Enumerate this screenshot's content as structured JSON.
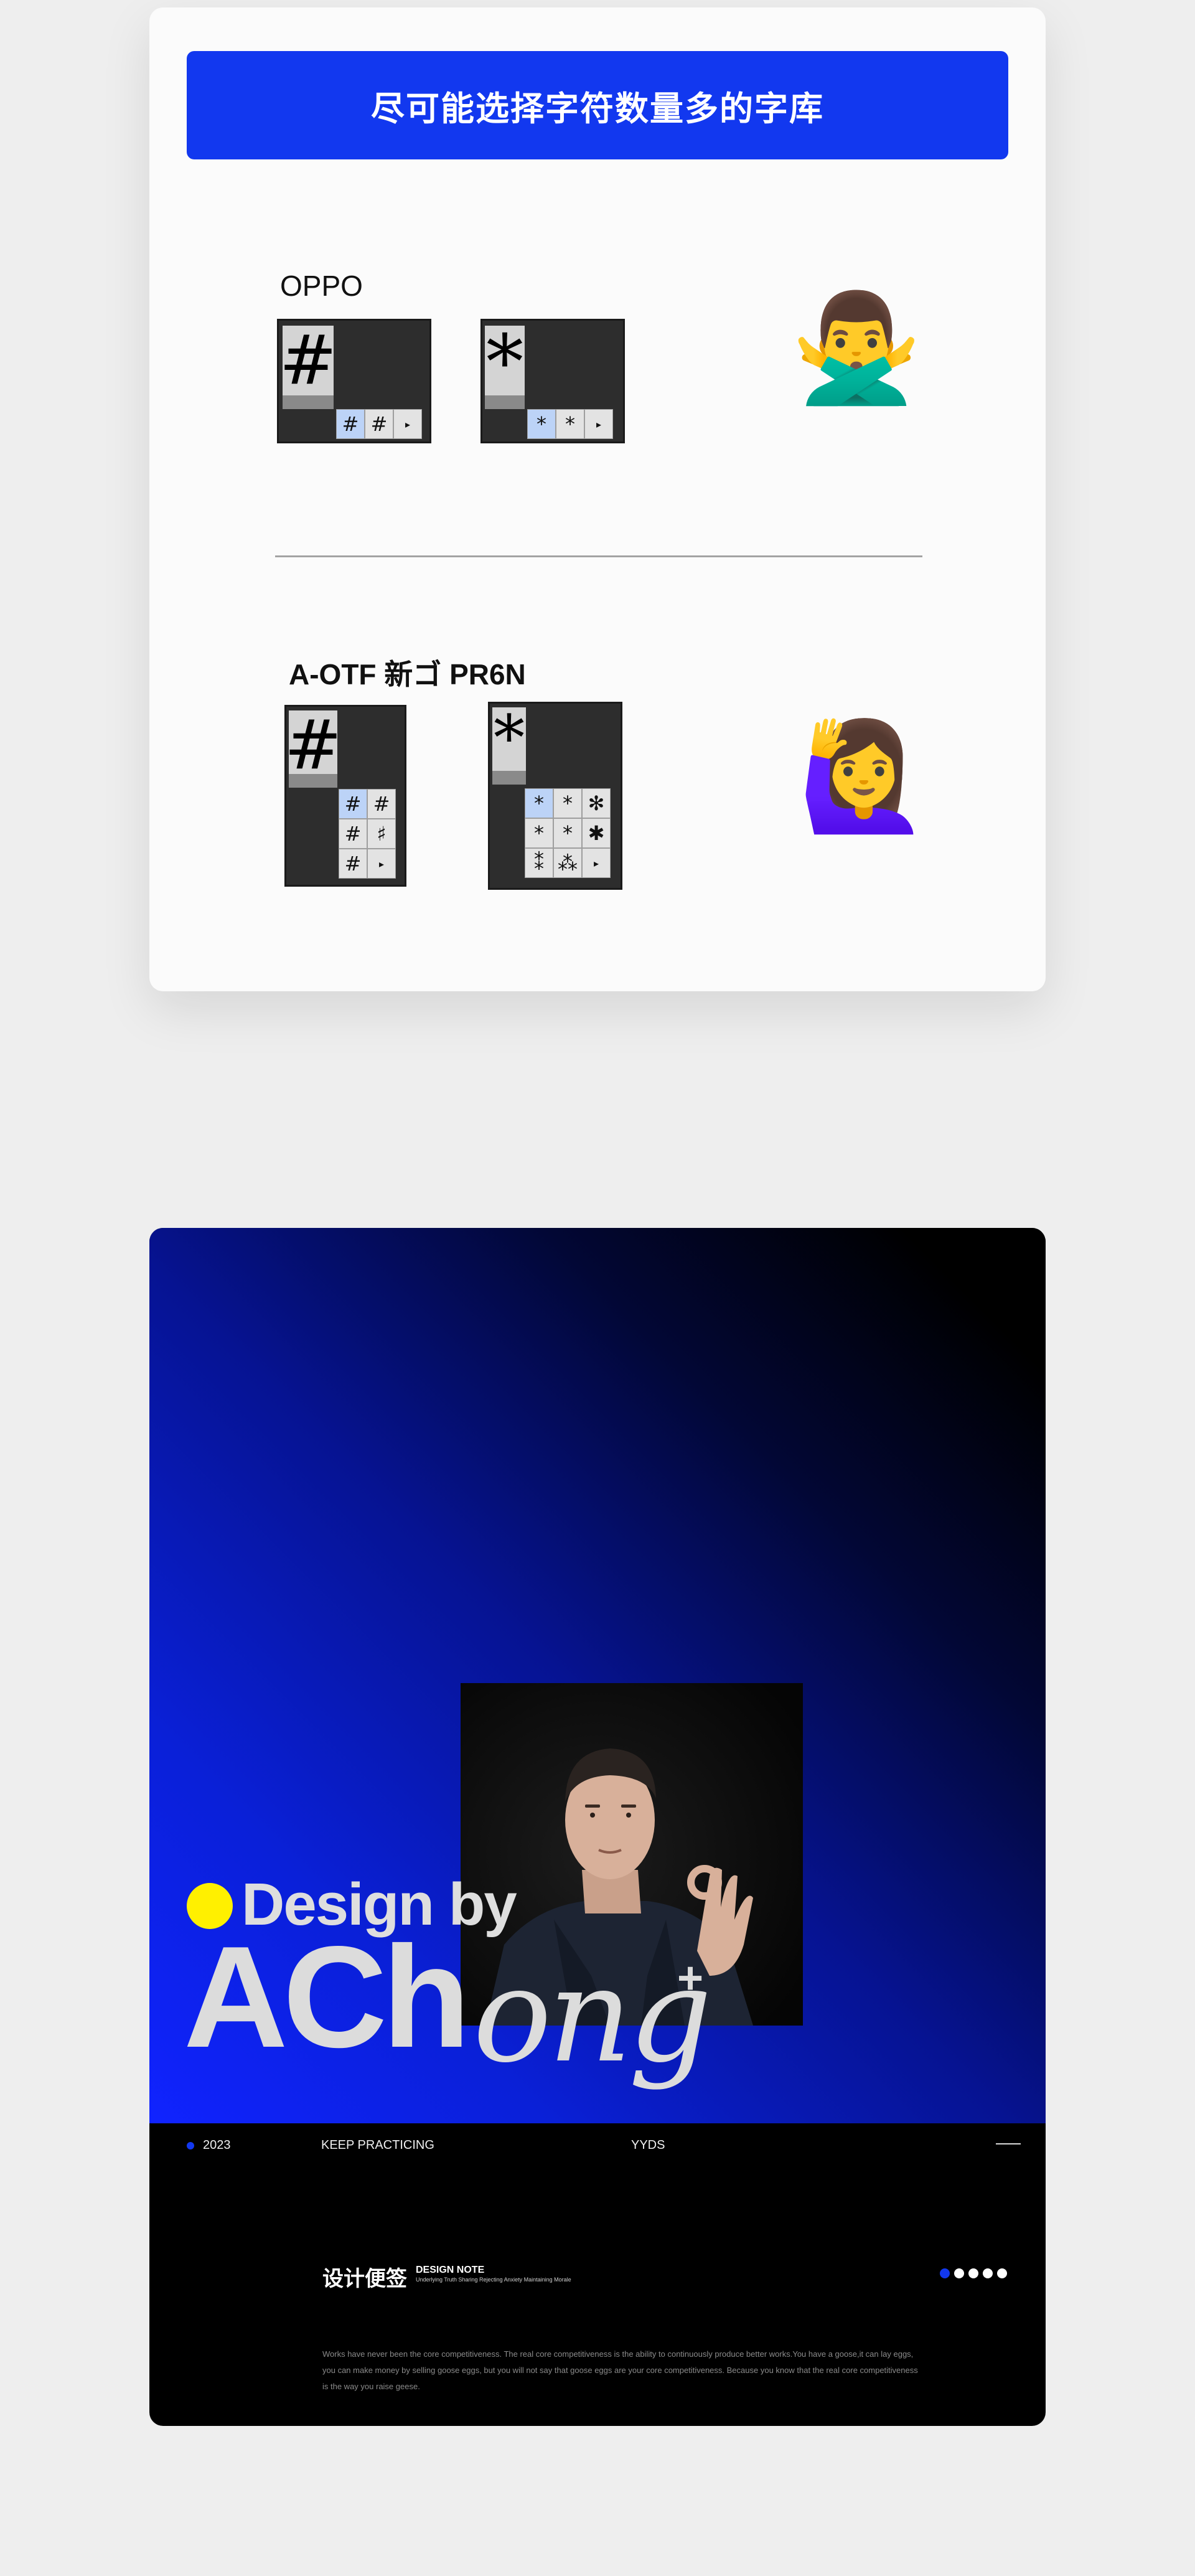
{
  "top_card": {
    "banner_title": "尽可能选择字符数量多的字库",
    "sections": [
      {
        "font_name": "OPPO",
        "hash_glyph": "#",
        "star_glyph": "*",
        "hash_alternates": [
          "#",
          "#"
        ],
        "star_alternates": [
          "*",
          "*"
        ],
        "verdict_emoji": "🙅‍♂️",
        "verdict_icon": "person-gesturing-no-icon"
      },
      {
        "font_name": "A-OTF 新ゴ PR6N",
        "hash_glyph": "#",
        "star_glyph": "*",
        "hash_alternates": [
          "#",
          "#",
          "#",
          "♯",
          "#"
        ],
        "star_alternates": [
          "*",
          "*",
          "✻",
          "*",
          "*",
          "✱",
          "⁑",
          "⁂"
        ],
        "verdict_emoji": "🙋‍♀️",
        "verdict_icon": "person-raising-hand-icon"
      }
    ],
    "arrow_glyph": "▸"
  },
  "bottom_card": {
    "design_by": "Design by",
    "brand_upright": "ACh",
    "brand_italic": "ong",
    "brand_plus": "+",
    "footer": {
      "year": "2023",
      "slogan": "KEEP PRACTICING",
      "tag": "YYDS"
    },
    "note": {
      "title_cn": "设计便签",
      "title_en": "DESIGN NOTE",
      "subtitle": "Underlying Truth Sharing Rejecting Anxiety Maintaining Morale",
      "pager_count": 5,
      "pager_active": 1,
      "paragraph_line1": "Works have never been the core competitiveness. The real core competitiveness is the ability to continuously produce better works.You have a goose,it can lay eggs,",
      "paragraph_line2": "you can make money by selling goose eggs, but you will not say that goose eggs are your core competitiveness. Because you know that the real core competitiveness",
      "paragraph_line3": "is the way you raise geese."
    },
    "colors": {
      "accent_blue": "#1238ef",
      "accent_yellow": "#fff000"
    }
  }
}
